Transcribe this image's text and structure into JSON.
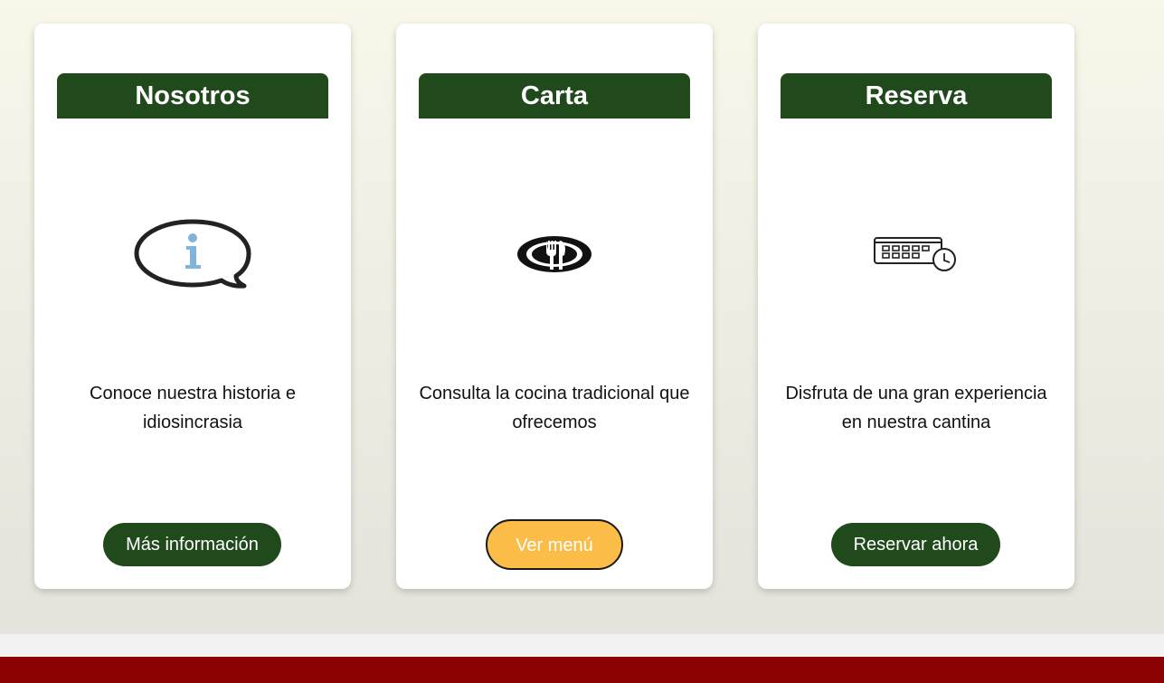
{
  "cards": [
    {
      "title": "Nosotros",
      "icon": "info-speech-bubble-icon",
      "description": "Conoce nuestra historia e idiosincrasia",
      "button": "Más información"
    },
    {
      "title": "Carta",
      "icon": "plate-fork-knife-icon",
      "description": "Consulta la cocina tradicional que ofrecemos",
      "button": "Ver menú"
    },
    {
      "title": "Reserva",
      "icon": "calendar-clock-icon",
      "description": "Disfruta de una gran experiencia en nuestra cantina",
      "button": "Reservar ahora"
    }
  ],
  "colors": {
    "title_bg": "#214a1c",
    "button_bg": "#214a1c",
    "button_active_bg": "#fcbd48",
    "info_accent": "#7fb4dc",
    "footer": "#8b0000"
  }
}
